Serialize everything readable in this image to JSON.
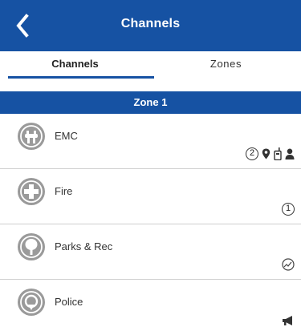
{
  "header": {
    "title": "Channels",
    "back_icon": "chevron-left-icon"
  },
  "tabs": [
    {
      "label": "Channels",
      "active": true
    },
    {
      "label": "Zones",
      "active": false
    }
  ],
  "zone": {
    "label": "Zone 1"
  },
  "channels": [
    {
      "label": "EMC",
      "icon": "emc-channel-icon",
      "status": {
        "count": "2",
        "icons": [
          "location-pin-icon",
          "radio-icon",
          "person-icon"
        ]
      }
    },
    {
      "label": "Fire",
      "icon": "fire-channel-icon",
      "status": {
        "count": "1",
        "icons": []
      }
    },
    {
      "label": "Parks & Rec",
      "icon": "parks-channel-icon",
      "status": {
        "count": "",
        "icons": [
          "activity-icon"
        ]
      }
    },
    {
      "label": "Police",
      "icon": "police-channel-icon",
      "status": {
        "count": "",
        "icons": [
          "megaphone-icon"
        ]
      }
    }
  ],
  "colors": {
    "primary": "#1652a3",
    "icon_gray": "#9a9a9a"
  }
}
